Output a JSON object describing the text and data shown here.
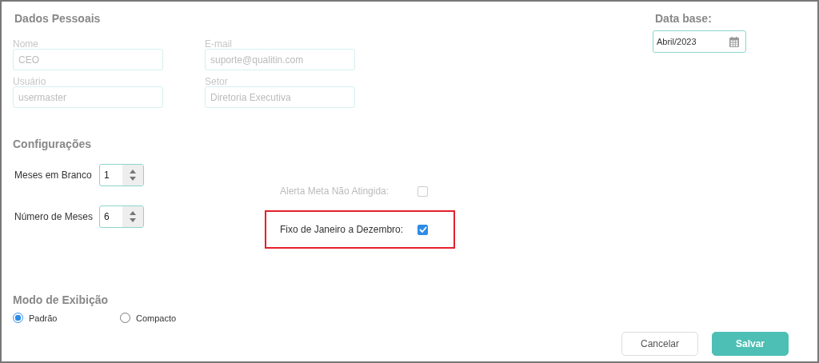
{
  "personal": {
    "title": "Dados Pessoais",
    "fields": [
      {
        "label": "Nome",
        "value": "CEO"
      },
      {
        "label": "E-mail",
        "value": "suporte@qualitin.com"
      },
      {
        "label": "Usuário",
        "value": "usermaster"
      },
      {
        "label": "Setor",
        "value": "Diretoria Executiva"
      }
    ]
  },
  "base_date": {
    "label": "Data base:",
    "value": "Abril/2023"
  },
  "settings": {
    "title": "Configurações",
    "spinners": [
      {
        "label": "Meses em Branco",
        "value": "1"
      },
      {
        "label": "Número de Meses",
        "value": "6"
      }
    ],
    "checkboxes": [
      {
        "label": "Alerta Meta Não Atingida:",
        "checked": false,
        "disabled": true,
        "highlighted": false
      },
      {
        "label": "Fixo de Janeiro a Dezembro:",
        "checked": true,
        "disabled": false,
        "highlighted": true
      }
    ]
  },
  "display_mode": {
    "title": "Modo de Exibição",
    "options": [
      {
        "label": "Padrão",
        "selected": true
      },
      {
        "label": "Compacto",
        "selected": false
      }
    ]
  },
  "buttons": [
    {
      "label": "Cancelar",
      "kind": "secondary"
    },
    {
      "label": "Salvar",
      "kind": "primary"
    }
  ]
}
